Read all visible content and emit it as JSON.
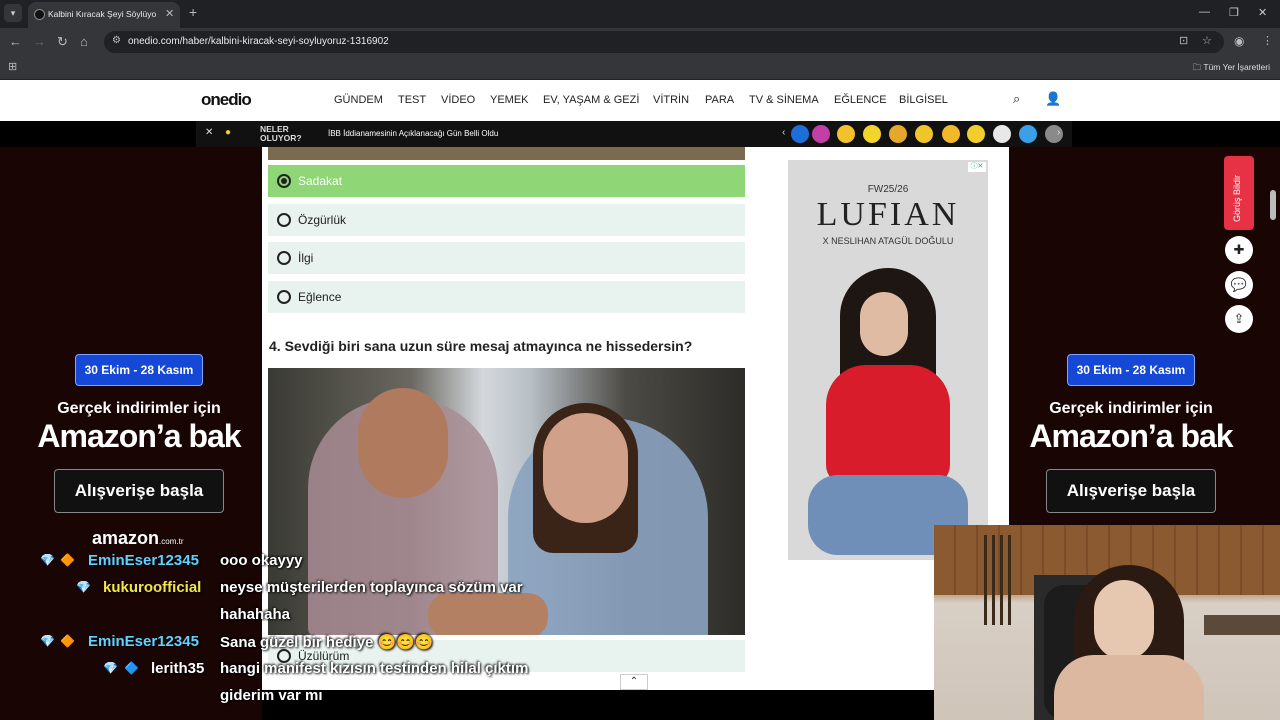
{
  "browser": {
    "tab_title": "Kalbini Kıracak Şeyi Söylüyoruz!",
    "url": "onedio.com/haber/kalbini-kiracak-seyi-soyluyoruz-1316902",
    "bookmarks_label": "Tüm Yer İşaretleri"
  },
  "site": {
    "logo": "onedio",
    "nav": [
      "GÜNDEM",
      "TEST",
      "VİDEO",
      "YEMEK",
      "EV, YAŞAM & GEZİ",
      "VİTRİN",
      "PARA",
      "TV & SİNEMA",
      "EĞLENCE",
      "BİLGİSEL"
    ]
  },
  "newsbar": {
    "neler_line1": "NELER",
    "neler_line2": "OLUYOR?",
    "headline": "İBB İddianamesinin Açıklanacağı Gün Belli Oldu"
  },
  "quiz": {
    "options": [
      {
        "label": "Sadakat",
        "selected": true
      },
      {
        "label": "Özgürlük",
        "selected": false
      },
      {
        "label": "İlgi",
        "selected": false
      },
      {
        "label": "Eğlence",
        "selected": false
      }
    ],
    "question": "4. Sevdiği biri sana uzun süre mesaj atmayınca ne hissedersin?",
    "next_option": "Üzülürüm"
  },
  "promo": {
    "date": "30 Ekim - 28 Kasım",
    "line1": "Gerçek indirimler için",
    "line2": "Amazon’a bak",
    "button": "Alışverişe başla",
    "amazon": "amazon",
    "amazon_tld": ".com.tr"
  },
  "ad": {
    "season": "FW25/26",
    "brand": "LUFIAN",
    "collab": "X NESLIHAN ATAGÜL DOĞULU"
  },
  "side_actions": {
    "feedback": "Görüş Bildir"
  },
  "chat": [
    {
      "user": "EminEser12345",
      "user_color": "#5fd3ff",
      "msg": "ooo okayyy"
    },
    {
      "user": "kukuroofficial",
      "user_color": "#f2e64a",
      "msg": "neyse müşterilerden toplayınca sözüm var"
    },
    {
      "user": "",
      "user_color": "#ffffff",
      "msg": "hahahaha"
    },
    {
      "user": "EminEser12345",
      "user_color": "#5fd3ff",
      "msg": "Sana güzel bir hediye 😊😊😊"
    },
    {
      "user": "lerith35",
      "user_color": "#ffffff",
      "msg": "hangi manifest kızısın testinden hilal çıktım"
    },
    {
      "user": "",
      "user_color": "#ffffff",
      "msg": "giderim var mı"
    }
  ]
}
